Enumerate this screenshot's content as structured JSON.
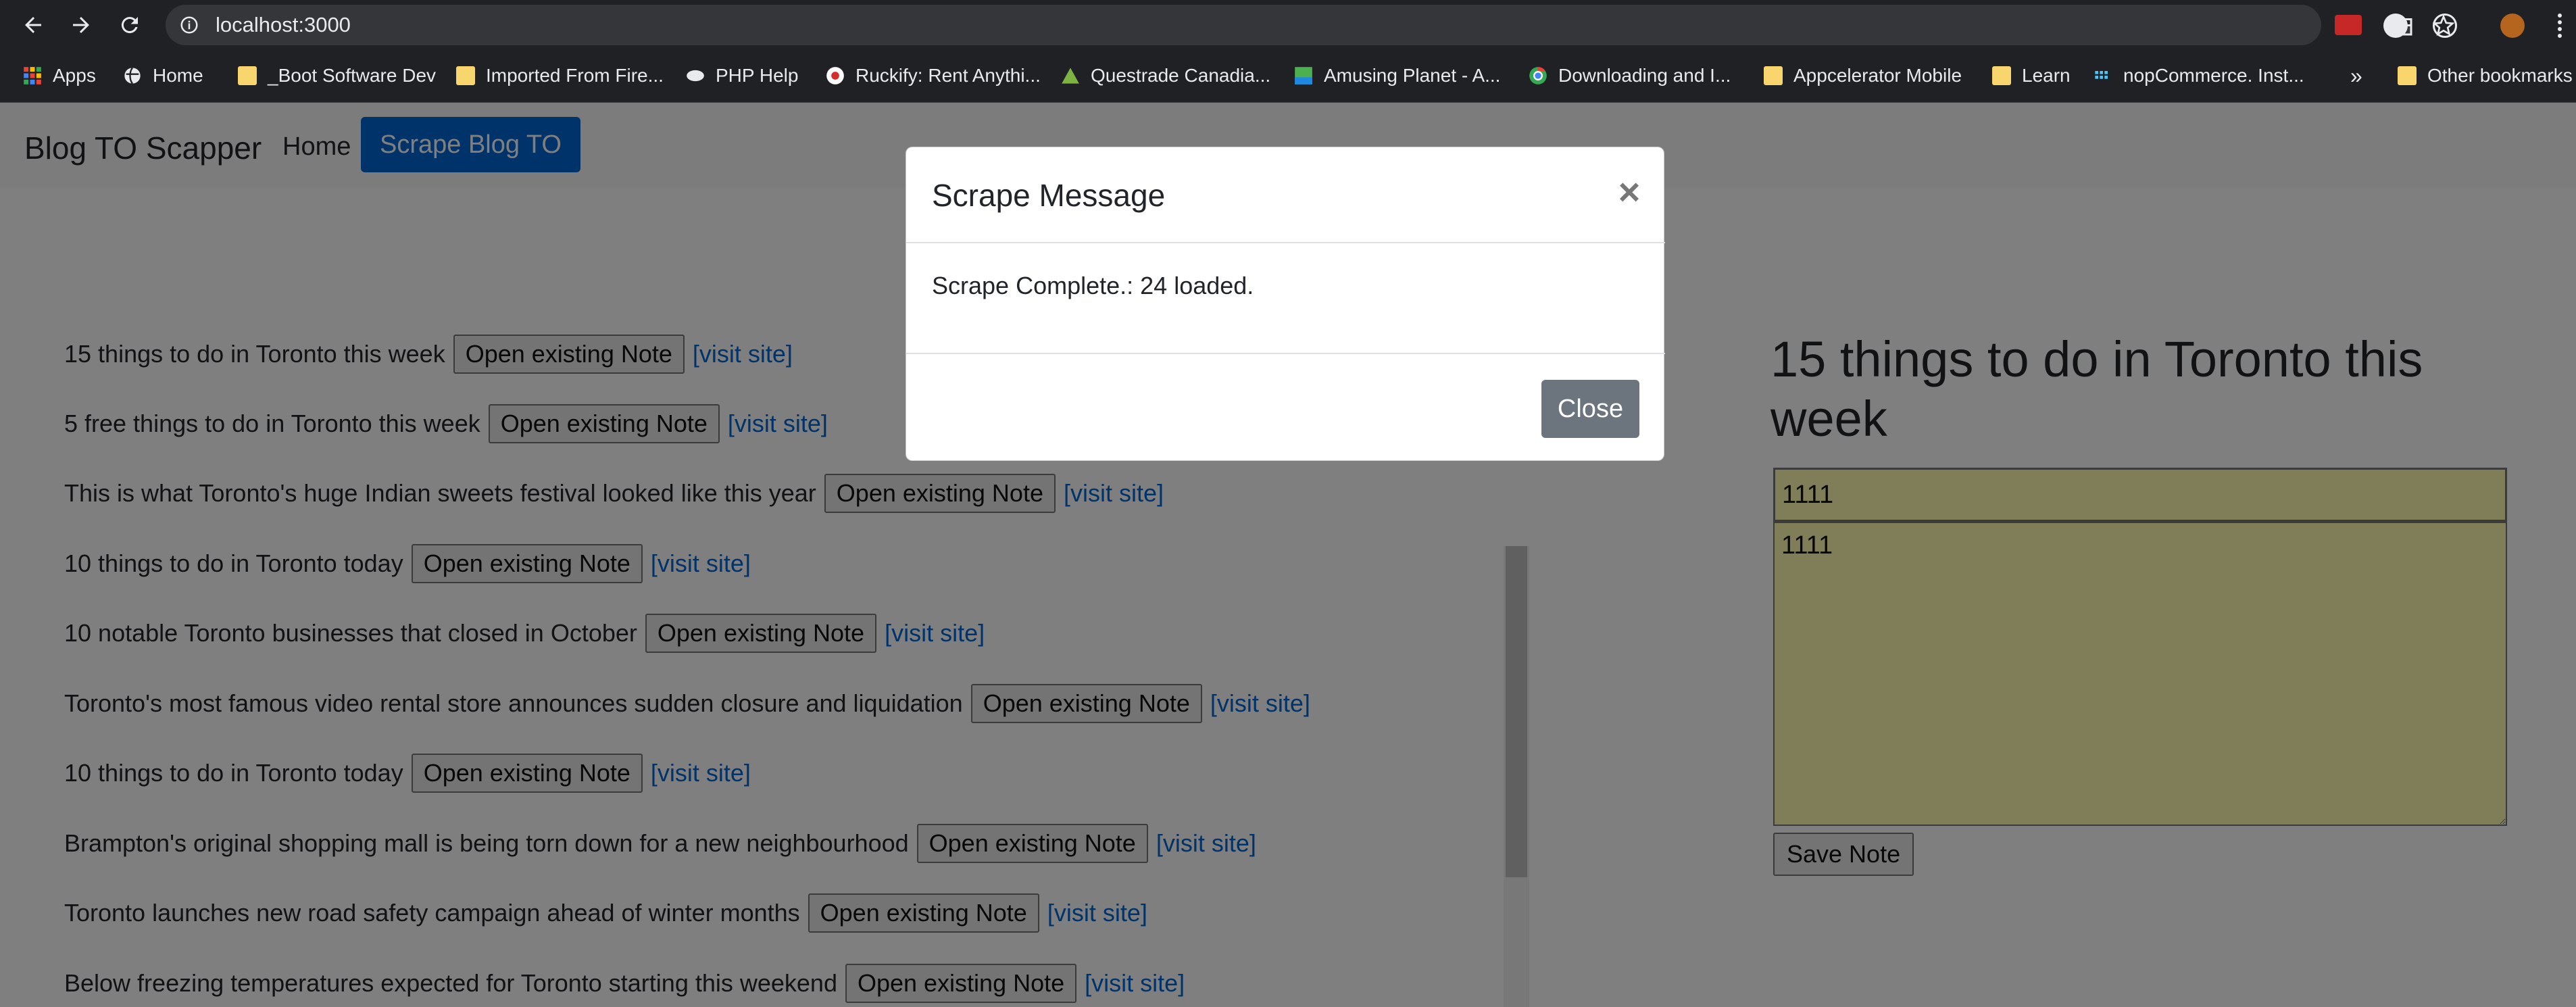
{
  "browser": {
    "url": "localhost:3000",
    "bookmarks": [
      {
        "label": "Apps",
        "icon": "apps-grid-icon"
      },
      {
        "label": "Home",
        "icon": "globe-icon"
      },
      {
        "label": "_Boot Software Dev",
        "icon": "folder-icon"
      },
      {
        "label": "Imported From Fire...",
        "icon": "folder-icon"
      },
      {
        "label": "PHP Help",
        "icon": "php-icon"
      },
      {
        "label": "Ruckify: Rent Anythi...",
        "icon": "ruckify-icon"
      },
      {
        "label": "Questrade Canadia...",
        "icon": "questrade-icon"
      },
      {
        "label": "Amusing Planet - A...",
        "icon": "image-icon"
      },
      {
        "label": "Downloading and I...",
        "icon": "chrome-icon"
      },
      {
        "label": "Appcelerator Mobile",
        "icon": "folder-icon"
      },
      {
        "label": "Learn",
        "icon": "folder-icon"
      },
      {
        "label": "nopCommerce. Inst...",
        "icon": "nopcommerce-icon"
      },
      {
        "label": "»",
        "icon": ""
      },
      {
        "label": "Other bookmarks",
        "icon": "folder-icon"
      }
    ]
  },
  "navbar": {
    "brand": "Blog TO Scapper",
    "home": "Home",
    "scrape": "Scrape Blog TO"
  },
  "articles": [
    {
      "title": "15 things to do in Toronto this week",
      "note_button": "Open existing Note",
      "link": "[visit site]"
    },
    {
      "title": "5 free things to do in Toronto this week",
      "note_button": "Open existing Note",
      "link": "[visit site]"
    },
    {
      "title": "This is what Toronto's huge Indian sweets festival looked like this year",
      "note_button": "Open existing Note",
      "link": "[visit site]"
    },
    {
      "title": "10 things to do in Toronto today",
      "note_button": "Open existing Note",
      "link": "[visit site]"
    },
    {
      "title": "10 notable Toronto businesses that closed in October",
      "note_button": "Open existing Note",
      "link": "[visit site]"
    },
    {
      "title": "Toronto's most famous video rental store announces sudden closure and liquidation",
      "note_button": "Open existing Note",
      "link": "[visit site]"
    },
    {
      "title": "10 things to do in Toronto today",
      "note_button": "Open existing Note",
      "link": "[visit site]"
    },
    {
      "title": "Brampton's original shopping mall is being torn down for a new neighbourhood",
      "note_button": "Open existing Note",
      "link": "[visit site]"
    },
    {
      "title": "Toronto launches new road safety campaign ahead of winter months",
      "note_button": "Open existing Note",
      "link": "[visit site]"
    },
    {
      "title": "Below freezing temperatures expected for Toronto starting this weekend",
      "note_button": "Open existing Note",
      "link": "[visit site]"
    }
  ],
  "note_panel": {
    "title": "15 things to do in Toronto this week",
    "input_value": "1111",
    "textarea_value": "1111",
    "save_label": "Save Note"
  },
  "modal": {
    "title": "Scrape Message",
    "close_x": "×",
    "body": "Scrape Complete.: 24 loaded.",
    "close_label": "Close"
  }
}
